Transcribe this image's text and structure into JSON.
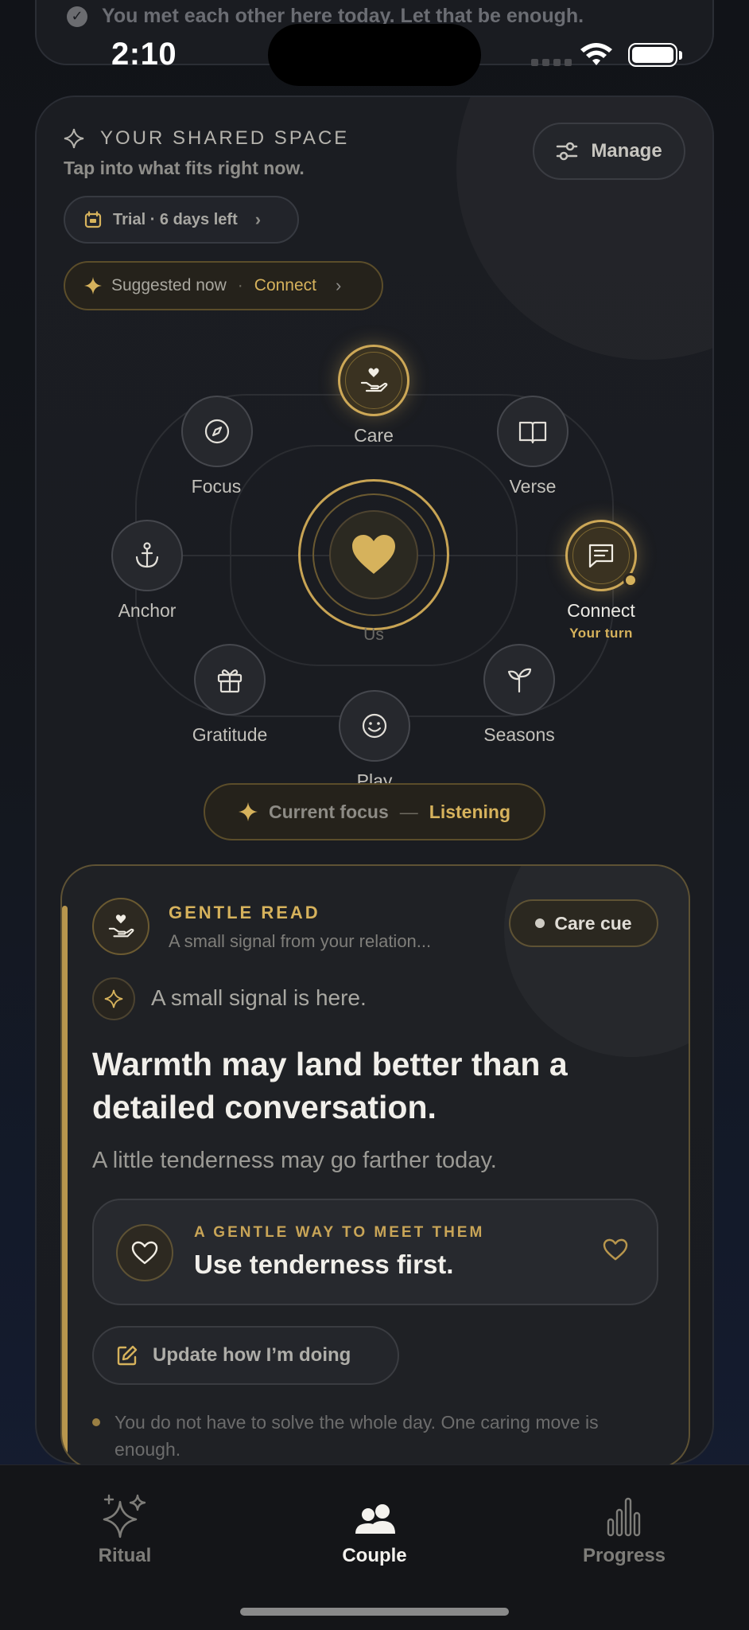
{
  "status_bar": {
    "time": "2:10"
  },
  "peek_card": {
    "message": "You met each other here today. Let that be enough."
  },
  "shared_space": {
    "title": "YOUR SHARED SPACE",
    "subtitle": "Tap into what fits right now.",
    "manage_label": "Manage",
    "trial_label": "Trial · 6 days left",
    "suggested_prefix": "Suggested now",
    "suggested_value": "Connect"
  },
  "orbit": {
    "center_label": "Us",
    "nodes": {
      "care": "Care",
      "focus": "Focus",
      "verse": "Verse",
      "anchor": "Anchor",
      "connect": "Connect",
      "gratitude": "Gratitude",
      "seasons": "Seasons",
      "play": "Play"
    },
    "connect_badge": "Your turn",
    "current_focus_label": "Current focus",
    "current_focus_dash": "—",
    "current_focus_value": "Listening"
  },
  "gentle_read": {
    "title": "GENTLE READ",
    "subtitle": "A small signal from your relation...",
    "badge": "Care cue",
    "signal_text": "A small signal is here.",
    "headline": "Warmth may land better than a detailed conversation.",
    "subline": "A little tenderness may go farther today.",
    "meet_kicker": "A GENTLE WAY TO MEET THEM",
    "meet_text": "Use tenderness first.",
    "update_label": "Update how I’m doing",
    "note": "You do not have to solve the whole day. One caring move is enough."
  },
  "tabbar": {
    "ritual": "Ritual",
    "couple": "Couple",
    "progress": "Progress",
    "active": "couple"
  },
  "colors": {
    "accent_gold": "#d6b25c",
    "background": "#131722"
  }
}
